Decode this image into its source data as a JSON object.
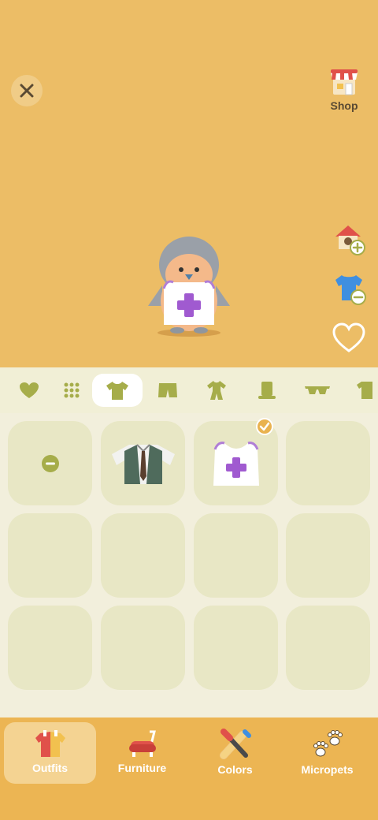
{
  "header": {
    "close_icon": "close-icon",
    "shop_label": "Shop"
  },
  "side_actions": [
    "home-add-icon",
    "shirt-remove-icon",
    "heart-icon"
  ],
  "categories": [
    "heart",
    "grid",
    "top",
    "bottoms",
    "onesie",
    "hat",
    "glasses",
    "more"
  ],
  "selected_category": "top",
  "outfit_items": [
    {
      "name": "none"
    },
    {
      "name": "shirt-tie-vest"
    },
    {
      "name": "tank-top-cross",
      "selected": true
    },
    {
      "name": "empty"
    }
  ],
  "tabs": {
    "outfits": "Outfits",
    "furniture": "Furniture",
    "colors": "Colors",
    "micropets": "Micropets"
  },
  "colors": {
    "stage_bg": "#ecbd66",
    "accent_olive": "#a6ad4a",
    "tab_bar": "#ecb553"
  }
}
